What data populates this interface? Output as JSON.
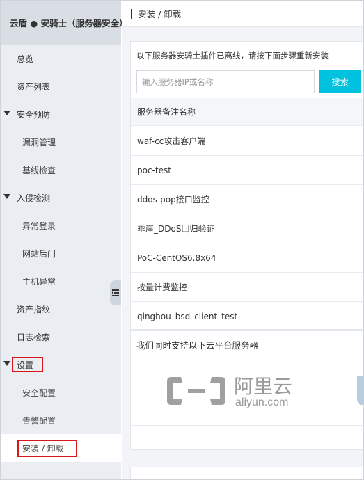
{
  "app": {
    "title": "云盾 ● 安骑士（服务器安全）"
  },
  "sidebar": {
    "items": [
      {
        "label": "总览",
        "level": 1
      },
      {
        "label": "资产列表",
        "level": 1
      },
      {
        "label": "安全预防",
        "level": 1,
        "expanded": true
      },
      {
        "label": "漏洞管理",
        "level": 2
      },
      {
        "label": "基线检查",
        "level": 2
      },
      {
        "label": "入侵检测",
        "level": 1,
        "expanded": true
      },
      {
        "label": "异常登录",
        "level": 2
      },
      {
        "label": "网站后门",
        "level": 2
      },
      {
        "label": "主机异常",
        "level": 2
      },
      {
        "label": "资产指纹",
        "level": 1
      },
      {
        "label": "日志检索",
        "level": 1
      },
      {
        "label": "设置",
        "level": 1,
        "expanded": true,
        "highlighted": true
      },
      {
        "label": "安全配置",
        "level": 2
      },
      {
        "label": "告警配置",
        "level": 2
      },
      {
        "label": "安装 / 卸载",
        "level": 2,
        "active": true,
        "highlighted": true
      }
    ]
  },
  "main": {
    "title": "安装 / 卸载",
    "notice": "以下服务器安骑士插件已离线，请按下面步骤重新安装",
    "search": {
      "placeholder": "输入服务器IP或名称",
      "value": "",
      "button_label": "搜索"
    },
    "table": {
      "header": "服务器备注名称",
      "rows": [
        "waf-cc攻击客户端",
        "poc-test",
        "ddos-pop接口监控",
        "乖崖_DDoS回归验证",
        "PoC-CentOS6.8x64",
        "按量计费监控",
        "qinghou_bsd_client_test"
      ]
    },
    "platforms": {
      "title": "我们同时支持以下云平台服务器",
      "logo_cn": "阿里云",
      "logo_en": "aliyun.com"
    }
  },
  "colors": {
    "accent": "#00c1de",
    "highlight": "#d9161c",
    "sidebar_bg": "#eaedf1",
    "sidebar_header_bg": "#d9dee4"
  }
}
